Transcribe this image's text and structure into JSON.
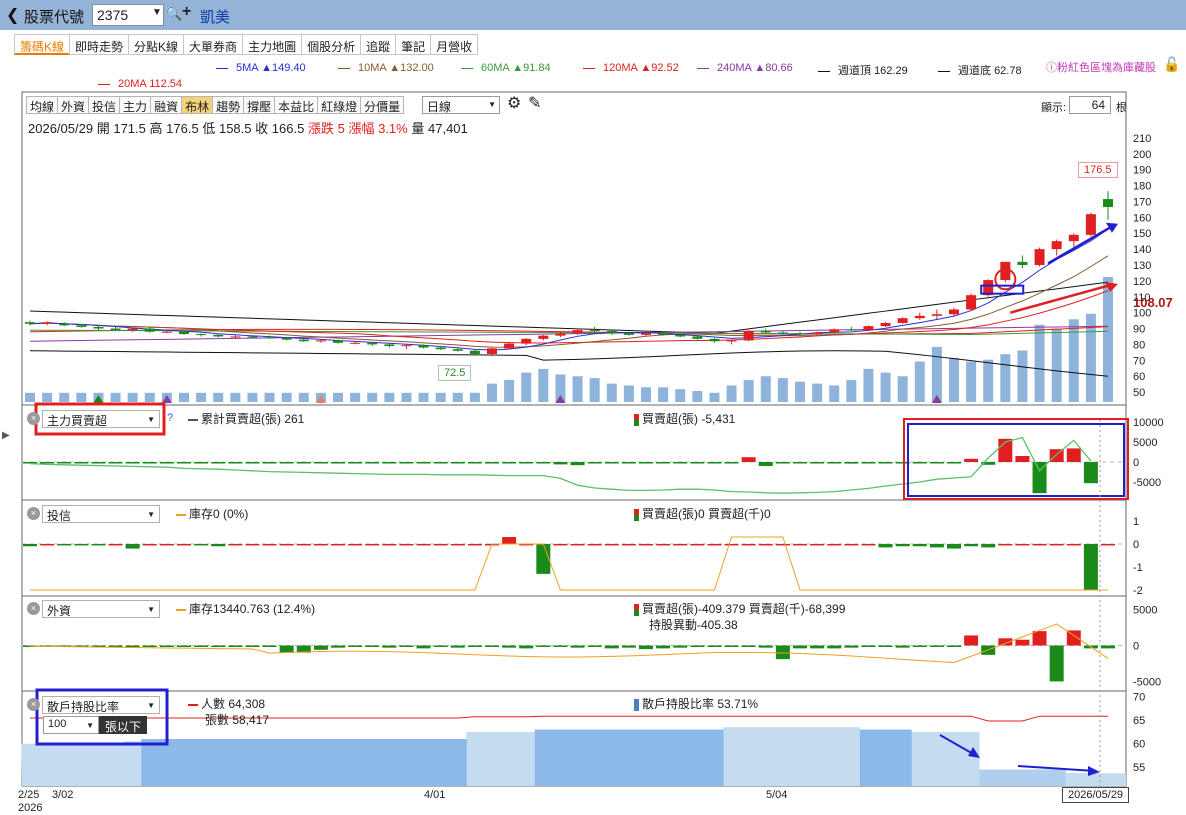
{
  "header": {
    "back_icon": "chevron-left-icon",
    "title": "股票代號",
    "stock_code": "2375",
    "stock_name": "凱美"
  },
  "tabs": [
    {
      "label": "籌碼K線",
      "active": true
    },
    {
      "label": "即時走勢"
    },
    {
      "label": "分點K線"
    },
    {
      "label": "大單券商"
    },
    {
      "label": "主力地圖"
    },
    {
      "label": "個股分析"
    },
    {
      "label": "追蹤"
    },
    {
      "label": "筆記"
    },
    {
      "label": "月營收"
    }
  ],
  "ma_legend": [
    {
      "name": "5MA",
      "value": "▲149.40",
      "color": "#2b2bd6"
    },
    {
      "name": "10MA",
      "value": "▲132.00",
      "color": "#8a5a2b"
    },
    {
      "name": "60MA",
      "value": "▲91.84",
      "color": "#3a9a3a"
    },
    {
      "name": "120MA",
      "value": "▲92.52",
      "color": "#e02020"
    },
    {
      "name": "240MA",
      "value": "▲80.66",
      "color": "#8a3aa0"
    },
    {
      "name": "週道頂",
      "value": "162.29",
      "color": "#111111"
    },
    {
      "name": "週道底",
      "value": "62.78",
      "color": "#111111"
    },
    {
      "name": "20MA",
      "value": "112.54",
      "color": "#e02020"
    }
  ],
  "vip_note": "ⓘ粉紅色區塊為庫藏股",
  "toolbar": {
    "buttons": [
      "均線",
      "外資",
      "投信",
      "主力",
      "融資",
      "布林",
      "趨勢",
      "撐壓",
      "本益比",
      "紅綠燈",
      "分價量"
    ],
    "selected": "布林",
    "period": "日線",
    "show_label": "顯示:",
    "show_count": "64",
    "show_unit": "根"
  },
  "quote": {
    "date": "2026/05/29",
    "open_label": "開",
    "open": "171.5",
    "high_label": "高",
    "high": "176.5",
    "low_label": "低",
    "low": "158.5",
    "close_label": "收",
    "close": "166.5",
    "change_label": "漲跌",
    "change": "5",
    "pct_label": "漲幅",
    "pct": "3.1%",
    "vol_label": "量",
    "vol": "47,401"
  },
  "price_tags": {
    "high_tag": "176.5",
    "low_tag": "72.5",
    "side_price": "108.07"
  },
  "panels": {
    "main_force": {
      "select": "主力買賣超",
      "cum_label": "累計買賣超(張) 261",
      "bs_label": "買賣超(張) -5,431"
    },
    "invest_trust": {
      "select": "投信",
      "inv_label": "庫存0 (0%)",
      "bs_label": "買賣超(張)0 買賣超(千)0"
    },
    "foreign": {
      "select": "外資",
      "inv_label": "庫存13440.763 (12.4%)",
      "bs_label": "買賣超(張)-409.379 買賣超(千)-68,399",
      "change_label": "持股異動-405.38"
    },
    "retail": {
      "select": "散戶持股比率",
      "people_label": "人數 64,308",
      "shares_label": "張數 58,417",
      "ratio_label": "散戶持股比率 53.71%",
      "threshold": "100",
      "threshold_unit": "張以下"
    }
  },
  "x_dates": {
    "start": "2/25",
    "start_year": "2026",
    "d1": "3/02",
    "d2": "4/01",
    "d3": "5/04",
    "end": "2026/05/29"
  },
  "chart_data": [
    {
      "type": "candlestick",
      "title": "2026/05/29",
      "ylim": [
        45,
        215
      ],
      "y_ticks": [
        210,
        200,
        190,
        180,
        170,
        160,
        150,
        140,
        130,
        120,
        110,
        100,
        90,
        80,
        70,
        60,
        50
      ],
      "candles": [
        [
          0,
          94,
          95,
          92,
          93
        ],
        [
          1,
          93,
          94.5,
          92,
          94
        ],
        [
          2,
          93,
          94,
          91.5,
          92
        ],
        [
          3,
          92,
          93,
          90.5,
          91
        ],
        [
          4,
          91,
          92,
          89,
          90
        ],
        [
          5,
          90,
          91,
          88.5,
          89
        ],
        [
          6,
          89,
          90.5,
          88,
          90
        ],
        [
          7,
          90,
          91,
          87.5,
          88
        ],
        [
          8,
          88,
          89,
          87,
          88
        ],
        [
          9,
          88,
          88.5,
          86,
          86.5
        ],
        [
          10,
          86.5,
          87,
          85,
          86
        ],
        [
          11,
          86,
          86.5,
          84.5,
          85
        ],
        [
          12,
          85,
          86,
          84,
          85
        ],
        [
          13,
          85,
          86,
          84,
          84.5
        ],
        [
          14,
          84.5,
          85.5,
          83.5,
          84
        ],
        [
          15,
          84,
          84.5,
          82.5,
          83
        ],
        [
          16,
          83,
          83.5,
          81.5,
          82
        ],
        [
          17,
          82,
          83,
          81,
          82.5
        ],
        [
          18,
          82.5,
          83,
          80.5,
          81
        ],
        [
          19,
          81,
          82,
          80,
          81
        ],
        [
          20,
          81,
          81.5,
          79,
          80
        ],
        [
          21,
          80,
          80.5,
          78,
          79
        ],
        [
          22,
          79,
          80,
          77,
          79.5
        ],
        [
          23,
          79.5,
          80,
          77.5,
          78
        ],
        [
          24,
          78,
          79,
          76.5,
          77
        ],
        [
          25,
          77,
          78,
          75.5,
          76
        ],
        [
          26,
          76,
          76.5,
          73.5,
          74
        ],
        [
          27,
          74,
          78,
          72.5,
          77.5
        ],
        [
          28,
          77.5,
          81,
          77,
          80.5
        ],
        [
          29,
          80.5,
          84,
          79.5,
          83.5
        ],
        [
          30,
          83.5,
          86,
          82.5,
          85.5
        ],
        [
          31,
          85.5,
          88,
          84.5,
          87
        ],
        [
          32,
          87,
          90,
          86,
          89
        ],
        [
          33,
          89,
          91,
          87.5,
          88.5
        ],
        [
          34,
          88.5,
          89.5,
          86,
          87
        ],
        [
          35,
          87,
          88,
          85.5,
          86
        ],
        [
          36,
          86,
          87.5,
          85,
          87
        ],
        [
          37,
          87,
          88,
          85.5,
          86
        ],
        [
          38,
          86,
          87,
          84.5,
          85
        ],
        [
          39,
          85,
          85.5,
          83,
          83.5
        ],
        [
          40,
          83.5,
          84,
          81,
          82
        ],
        [
          41,
          82,
          83,
          80,
          82.5
        ],
        [
          42,
          82.5,
          89,
          82,
          88.5
        ],
        [
          43,
          88.5,
          90,
          87,
          87.5
        ],
        [
          44,
          87.5,
          88.5,
          86,
          87
        ],
        [
          45,
          87,
          88,
          85.5,
          86.5
        ],
        [
          46,
          86.5,
          88,
          85.5,
          87.5
        ],
        [
          47,
          87.5,
          90,
          87,
          89.5
        ],
        [
          48,
          89.5,
          91,
          88.5,
          89
        ],
        [
          49,
          89,
          92,
          88.5,
          91.5
        ],
        [
          50,
          91.5,
          94,
          91,
          93.5
        ],
        [
          51,
          93.5,
          97,
          93,
          96.5
        ],
        [
          52,
          96.5,
          100,
          95.5,
          98
        ],
        [
          53,
          98,
          102,
          96,
          99
        ],
        [
          54,
          99,
          103,
          97.5,
          102
        ],
        [
          55,
          102,
          112,
          101,
          111
        ],
        [
          56,
          111,
          121,
          110,
          120.5
        ],
        [
          57,
          120.5,
          128,
          119,
          132
        ],
        [
          58,
          132,
          136,
          128,
          130
        ],
        [
          59,
          130,
          141,
          129,
          140
        ],
        [
          60,
          140,
          146,
          136,
          145
        ],
        [
          61,
          145,
          150,
          140,
          149
        ],
        [
          62,
          149,
          163,
          148,
          162
        ],
        [
          63,
          171.5,
          176.5,
          158.5,
          166.5
        ]
      ],
      "volume": [
        5,
        5,
        5,
        5,
        5,
        5,
        5,
        5,
        5,
        5,
        5,
        5,
        5,
        5,
        5,
        5,
        5,
        5,
        5,
        5,
        5,
        5,
        5,
        5,
        5,
        5,
        5,
        10,
        12,
        16,
        18,
        15,
        14,
        13,
        10,
        9,
        8,
        8,
        7,
        6,
        5,
        9,
        12,
        14,
        13,
        11,
        10,
        9,
        12,
        18,
        16,
        14,
        22,
        30,
        24,
        22,
        23,
        26,
        28,
        42,
        40,
        45,
        48,
        68
      ]
    },
    {
      "type": "bar",
      "title": "主力買賣超",
      "ylim": [
        -7000,
        11000
      ],
      "y_ticks": [
        10000,
        5000,
        0,
        -5000
      ],
      "values": [
        -200,
        -100,
        -150,
        -50,
        -100,
        -200,
        -80,
        -60,
        -100,
        -300,
        -50,
        -100,
        -200,
        -150,
        -100,
        -50,
        -80,
        -120,
        -60,
        -100,
        -150,
        -50,
        -80,
        -300,
        -200,
        -100,
        -50,
        -80,
        -150,
        -100,
        -50,
        -600,
        -800,
        -300,
        -100,
        -200,
        -100,
        -50,
        -80,
        -100,
        -50,
        -100,
        1200,
        -1000,
        -200,
        -150,
        -300,
        -200,
        -400,
        -100,
        -200,
        -300,
        -200,
        -100,
        -150,
        800,
        -700,
        5800,
        1500,
        -7800,
        3200,
        3400,
        -5300
      ],
      "cumulative": [
        -400,
        -600,
        -700,
        -800,
        -900,
        -1000,
        -1100,
        -1200,
        -1300,
        -1600,
        -1700,
        -1800,
        -2000,
        -2200,
        -2400,
        -2500,
        -2600,
        -2700,
        -2800,
        -2900,
        -3000,
        -3100,
        -3100,
        -3100,
        -3200,
        -3200,
        -3200,
        -3300,
        -3400,
        -3400,
        -3400,
        -4100,
        -5800,
        -6500,
        -6800,
        -7100,
        -7100,
        -7000,
        -6800,
        -6800,
        -7000,
        -7400,
        -7500,
        -7700,
        -7800,
        -7700,
        -7600,
        -7400,
        -7000,
        -6600,
        -6000,
        -5500,
        -5000,
        -4300,
        -4000,
        -3700,
        1000,
        5000,
        6100,
        -2200,
        1900,
        5400,
        261
      ]
    },
    {
      "type": "bar",
      "title": "投信",
      "ylim": [
        -2,
        1.3
      ],
      "y_ticks": [
        1,
        0,
        -1,
        -2
      ],
      "values": [
        -0.1,
        0,
        -0.05,
        -0.05,
        -0.05,
        0,
        -0.2,
        0,
        0,
        0,
        -0.05,
        -0.1,
        0,
        0,
        0,
        0,
        0,
        0,
        0,
        0,
        0,
        0,
        0,
        0,
        0,
        0,
        0,
        0,
        0.3,
        0,
        -1.3,
        0,
        0,
        0,
        0,
        0,
        0,
        0,
        0,
        0,
        0,
        0,
        0,
        0,
        0,
        0,
        0,
        0,
        0,
        0,
        -0.15,
        -0.1,
        -0.1,
        -0.15,
        -0.2,
        -0.1,
        -0.15,
        0,
        0,
        0,
        0,
        0,
        -2,
        0
      ]
    },
    {
      "type": "bar",
      "title": "外資",
      "ylim": [
        -5500,
        5500
      ],
      "y_ticks": [
        5000,
        0,
        -5000
      ],
      "values": [
        -50,
        -50,
        -100,
        -50,
        -100,
        -200,
        -150,
        -100,
        -50,
        -150,
        -100,
        -200,
        -100,
        -50,
        -100,
        -1000,
        -1000,
        -600,
        -300,
        -100,
        -200,
        -300,
        -200,
        -400,
        -200,
        -300,
        -100,
        -200,
        -300,
        -400,
        -200,
        -100,
        -300,
        -100,
        -400,
        -300,
        -500,
        -400,
        -300,
        -200,
        -200,
        -100,
        -100,
        -300,
        -1900,
        -400,
        -400,
        -400,
        -300,
        -200,
        -100,
        -300,
        -200,
        -200,
        -100,
        1400,
        -1300,
        1000,
        800,
        2000,
        -5000,
        2100,
        -400,
        -400
      ]
    },
    {
      "type": "area",
      "title": "散戶持股比率",
      "ylim": [
        51,
        71
      ],
      "y_ticks": [
        70,
        65,
        60,
        55
      ],
      "values": [
        60,
        60,
        60,
        60,
        60,
        60,
        60.5,
        61,
        61,
        61,
        61,
        61,
        61,
        61,
        61,
        61,
        61,
        61,
        61,
        61,
        61,
        61,
        61,
        61,
        61,
        61,
        62.5,
        62.5,
        62.5,
        62.5,
        63,
        63,
        63,
        63,
        63,
        63,
        63,
        63,
        63,
        63,
        63,
        63.5,
        63.5,
        63.5,
        63.5,
        63.5,
        63.5,
        63.5,
        63.5,
        63,
        63,
        63,
        62.5,
        62.5,
        62.5,
        62.5,
        54.5,
        54.5,
        54.5,
        54.5,
        54.5,
        53.8,
        53.8,
        53.7
      ],
      "people": [
        64,
        64,
        64,
        64,
        64,
        64,
        64,
        64,
        64,
        64,
        64,
        64,
        64,
        64,
        64,
        64,
        64,
        64,
        64,
        64,
        64,
        64,
        64,
        64,
        64,
        64,
        64.2,
        64.2,
        64.2,
        64.2,
        64.3,
        64.3,
        64.3,
        64.3,
        64.3,
        64.3,
        64.3,
        64.3,
        64.3,
        64.3,
        64.3,
        64.3,
        64.3,
        64.3,
        64.3,
        64.3,
        64.3,
        64.3,
        64.3,
        64.3,
        64.3,
        64.3,
        64.3,
        64.3,
        64.3,
        64.3,
        63.5,
        63.5,
        63.5,
        64.3,
        64.3,
        64.3,
        64.3,
        64.3
      ]
    }
  ]
}
